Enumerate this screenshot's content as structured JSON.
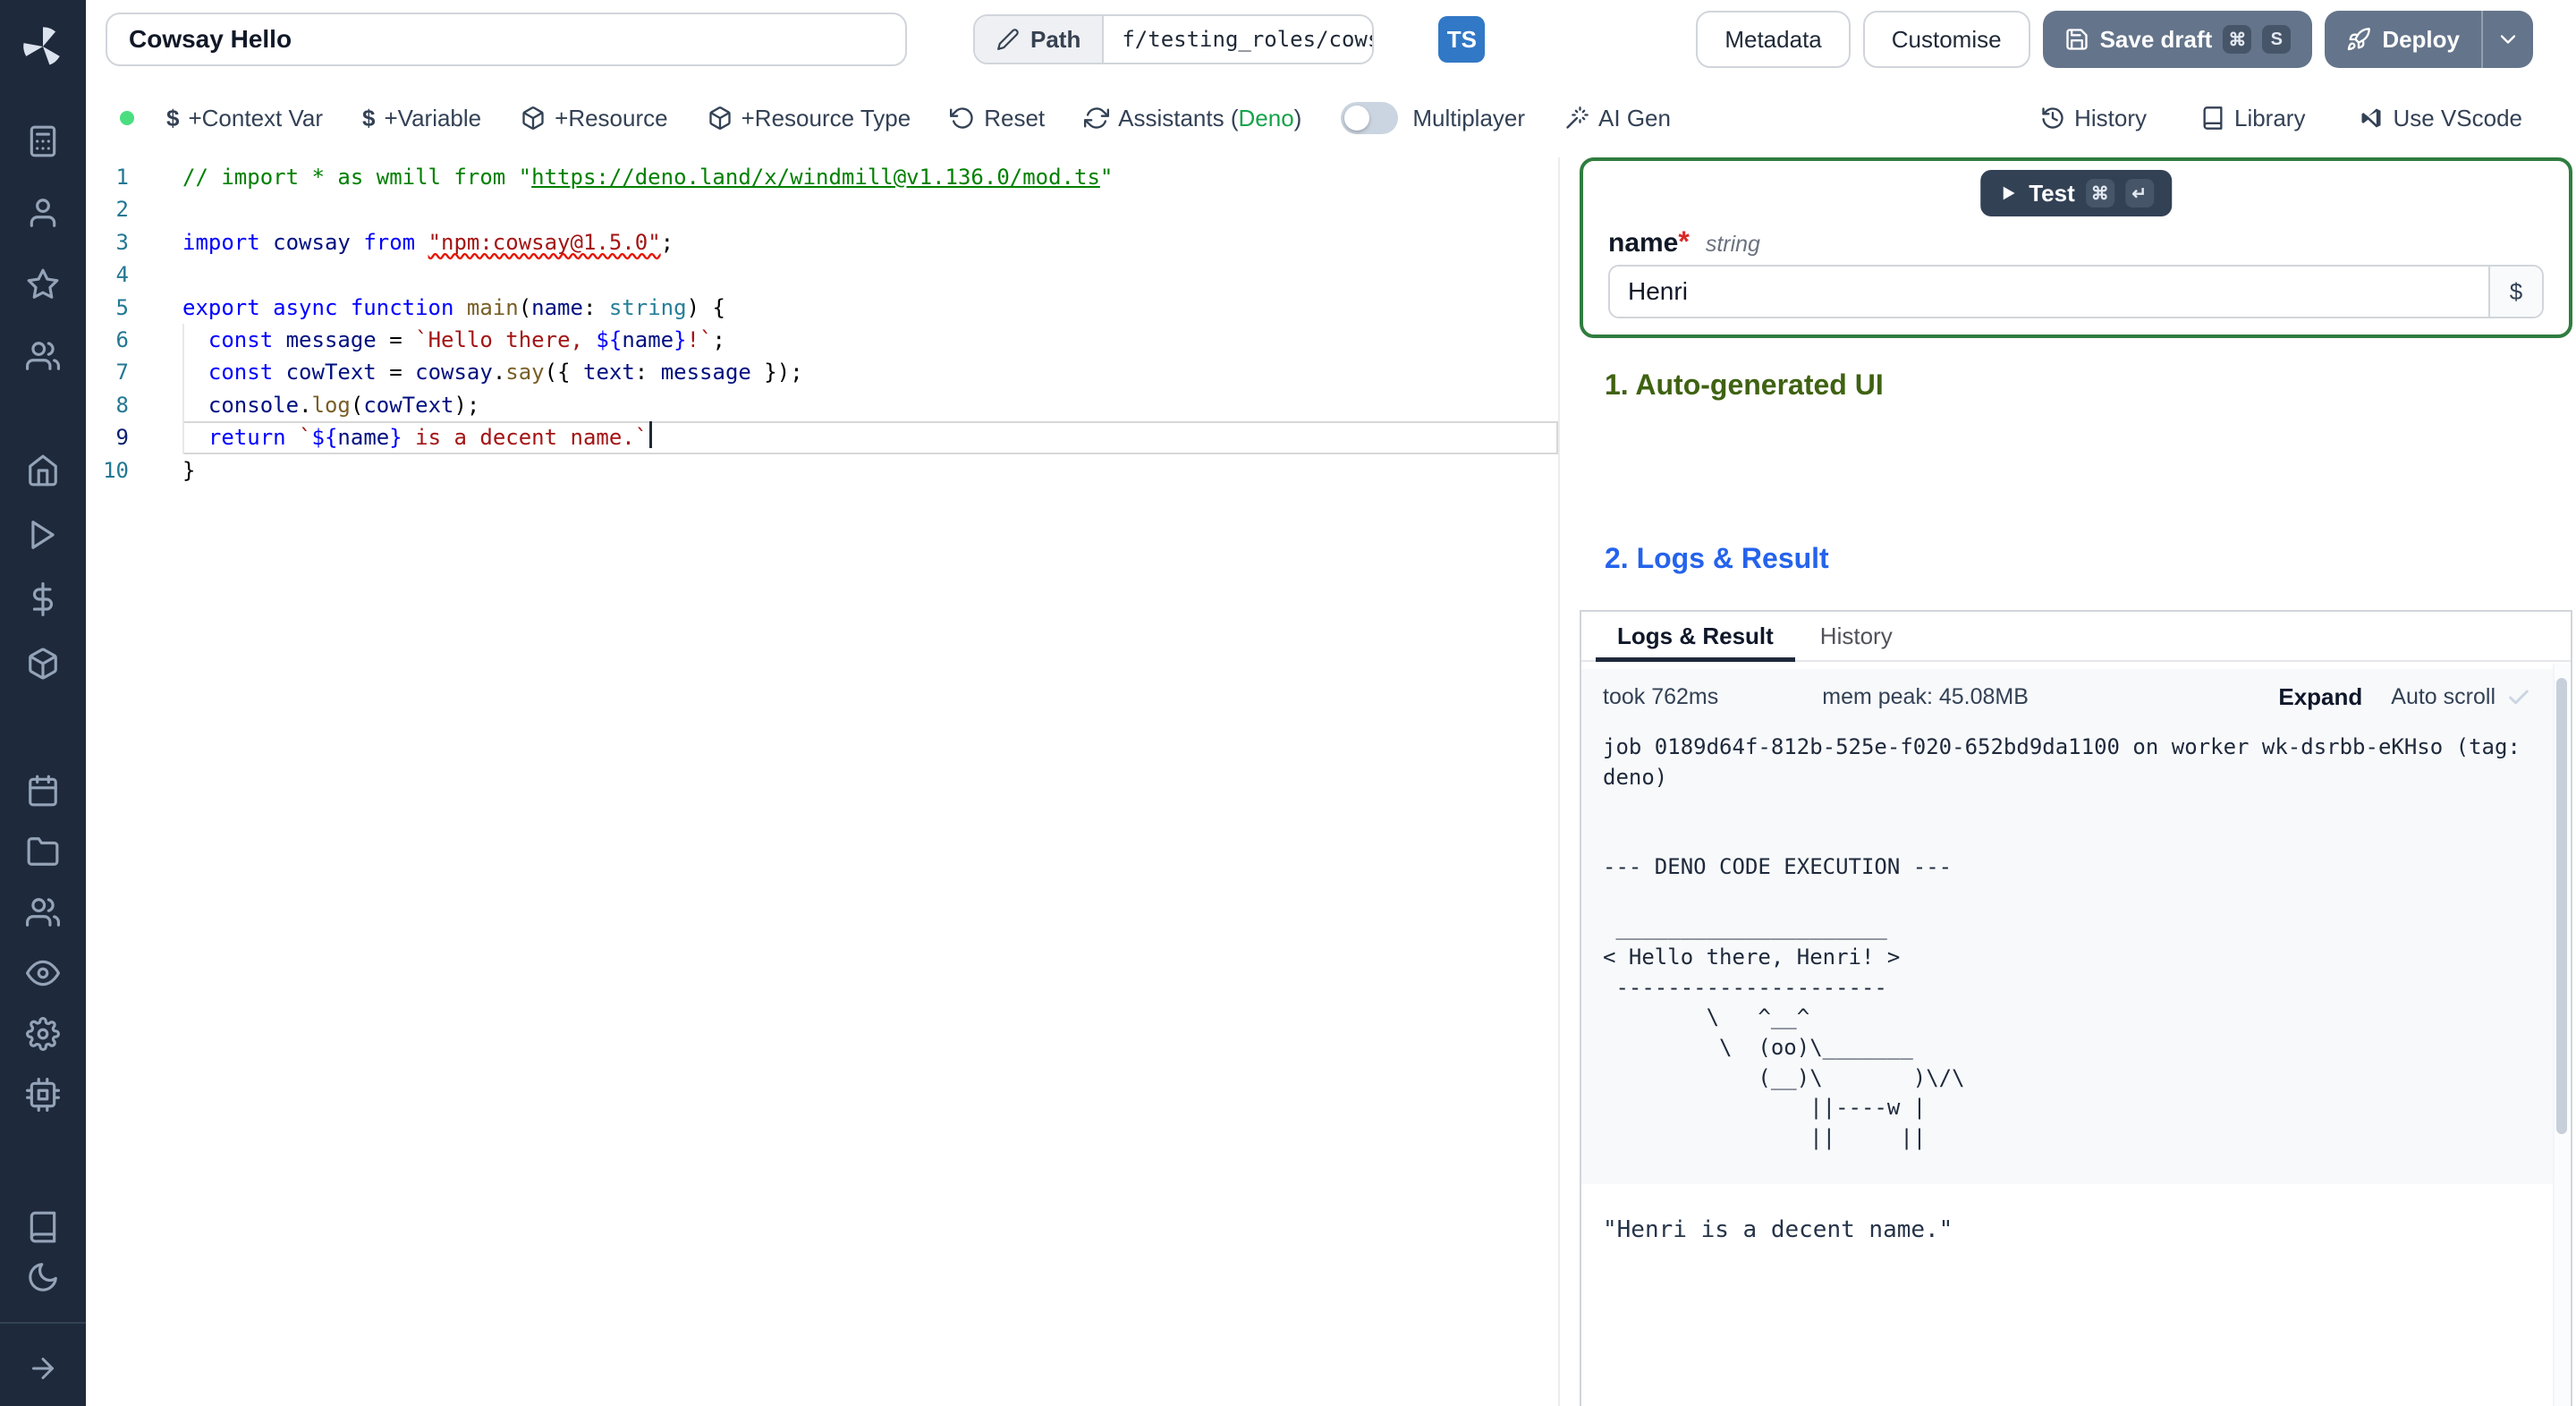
{
  "colors": {
    "sidebar_bg": "#1e293b",
    "primary_button_bg": "#64748b",
    "ts_badge_bg": "#3178c6",
    "form_valid_border": "#2f7d3f",
    "section1_color": "#3f6212",
    "section2_color": "#2563eb",
    "error_red": "#e51400",
    "status_dot": "#4ade80"
  },
  "icons": {
    "sidebar": [
      "windmill-logo",
      "calculator-icon",
      "user-icon",
      "star-icon",
      "users-icon",
      "home-icon",
      "play-icon",
      "dollar-icon",
      "package-icon",
      "calendar-icon",
      "folder-icon",
      "user-group-icon",
      "eye-icon",
      "gear-icon",
      "cpu-icon",
      "book-icon",
      "moon-icon",
      "arrow-right-icon"
    ],
    "header": [
      "pencil-icon",
      "save-icon",
      "rocket-icon",
      "chevron-down-icon"
    ],
    "toolbar": [
      "dollar-icon",
      "package-icon",
      "rotate-ccw-icon",
      "refresh-icon",
      "wand-icon",
      "history-icon",
      "library-icon",
      "vscode-icon"
    ],
    "panel": [
      "play-icon",
      "check-icon"
    ]
  },
  "header": {
    "script_name": "Cowsay Hello",
    "path_label": "Path",
    "path_value": "f/testing_roles/cowsa",
    "lang_badge": "TS",
    "metadata": "Metadata",
    "customise": "Customise",
    "save_draft": "Save draft",
    "save_kbd": [
      "⌘",
      "S"
    ],
    "deploy": "Deploy"
  },
  "toolbar": {
    "dollar": "$",
    "context_var": "+Context Var",
    "variable": "+Variable",
    "resource": "+Resource",
    "resource_type": "+Resource Type",
    "reset": "Reset",
    "assistants": "Assistants (",
    "assistants_lang": "Deno",
    "assistants_close": ")",
    "multiplayer": "Multiplayer",
    "ai_gen": "AI Gen",
    "history": "History",
    "library": "Library",
    "use_vscode": "Use VScode"
  },
  "editor": {
    "active_line": 9,
    "cursor_line": 9,
    "line_numbers": [
      1,
      2,
      3,
      4,
      5,
      6,
      7,
      8,
      9,
      10
    ],
    "lines": [
      [
        [
          "c",
          "// import * as wmill from \""
        ],
        [
          "cl",
          "https://deno.land/x/windmill@v1.136.0/mod.ts"
        ],
        [
          "c",
          "\""
        ]
      ],
      [],
      [
        [
          "k",
          "import"
        ],
        [
          "p",
          " "
        ],
        [
          "v",
          "cowsay"
        ],
        [
          "p",
          " "
        ],
        [
          "k",
          "from"
        ],
        [
          "p",
          " "
        ],
        [
          "se",
          "\"npm:cowsay@1.5.0\""
        ],
        [
          "p",
          ";"
        ]
      ],
      [],
      [
        [
          "k",
          "export"
        ],
        [
          "p",
          " "
        ],
        [
          "k",
          "async"
        ],
        [
          "p",
          " "
        ],
        [
          "k",
          "function"
        ],
        [
          "p",
          " "
        ],
        [
          "f",
          "main"
        ],
        [
          "p",
          "("
        ],
        [
          "v",
          "name"
        ],
        [
          "p",
          ": "
        ],
        [
          "t",
          "string"
        ],
        [
          "p",
          ") {"
        ]
      ],
      [
        [
          "p",
          "  "
        ],
        [
          "k",
          "const"
        ],
        [
          "p",
          " "
        ],
        [
          "v",
          "message"
        ],
        [
          "p",
          " = "
        ],
        [
          "s",
          "`Hello there, "
        ],
        [
          "k",
          "${"
        ],
        [
          "v",
          "name"
        ],
        [
          "k",
          "}"
        ],
        [
          "s",
          "!`"
        ],
        [
          "p",
          ";"
        ]
      ],
      [
        [
          "p",
          "  "
        ],
        [
          "k",
          "const"
        ],
        [
          "p",
          " "
        ],
        [
          "v",
          "cowText"
        ],
        [
          "p",
          " = "
        ],
        [
          "v",
          "cowsay"
        ],
        [
          "p",
          "."
        ],
        [
          "f",
          "say"
        ],
        [
          "p",
          "({ "
        ],
        [
          "v",
          "text"
        ],
        [
          "p",
          ": "
        ],
        [
          "v",
          "message"
        ],
        [
          "p",
          " });"
        ]
      ],
      [
        [
          "p",
          "  "
        ],
        [
          "v",
          "console"
        ],
        [
          "p",
          "."
        ],
        [
          "f",
          "log"
        ],
        [
          "p",
          "("
        ],
        [
          "v",
          "cowText"
        ],
        [
          "p",
          ");"
        ]
      ],
      [
        [
          "p",
          "  "
        ],
        [
          "k",
          "return"
        ],
        [
          "p",
          " "
        ],
        [
          "s",
          "`"
        ],
        [
          "k",
          "${"
        ],
        [
          "v",
          "name"
        ],
        [
          "k",
          "}"
        ],
        [
          "s",
          " is a decent name.`"
        ]
      ],
      [
        [
          "p",
          "}"
        ]
      ]
    ]
  },
  "panel": {
    "test": "Test",
    "test_kbd": [
      "⌘",
      "↵"
    ],
    "arg_name": "name",
    "required_mark": "*",
    "arg_type": "string",
    "arg_value": "Henri",
    "dollar": "$",
    "section1": "1. Auto-generated UI",
    "section2": "2. Logs & Result",
    "tab_logs": "Logs & Result",
    "tab_history": "History",
    "took": "took 762ms",
    "mem_peak": "mem peak: 45.08MB",
    "expand": "Expand",
    "auto_scroll": "Auto scroll",
    "log_lines": [
      "job 0189d64f-812b-525e-f020-652bd9da1100 on worker wk-dsrbb-eKHso (tag:",
      "deno)",
      "",
      "",
      "--- DENO CODE EXECUTION ---",
      "",
      " _____________________",
      "< Hello there, Henri! >",
      " ---------------------",
      "        \\   ^__^",
      "         \\  (oo)\\_______",
      "            (__)\\       )\\/\\",
      "                ||----w |",
      "                ||     ||"
    ],
    "result": "\"Henri is a decent name.\""
  }
}
